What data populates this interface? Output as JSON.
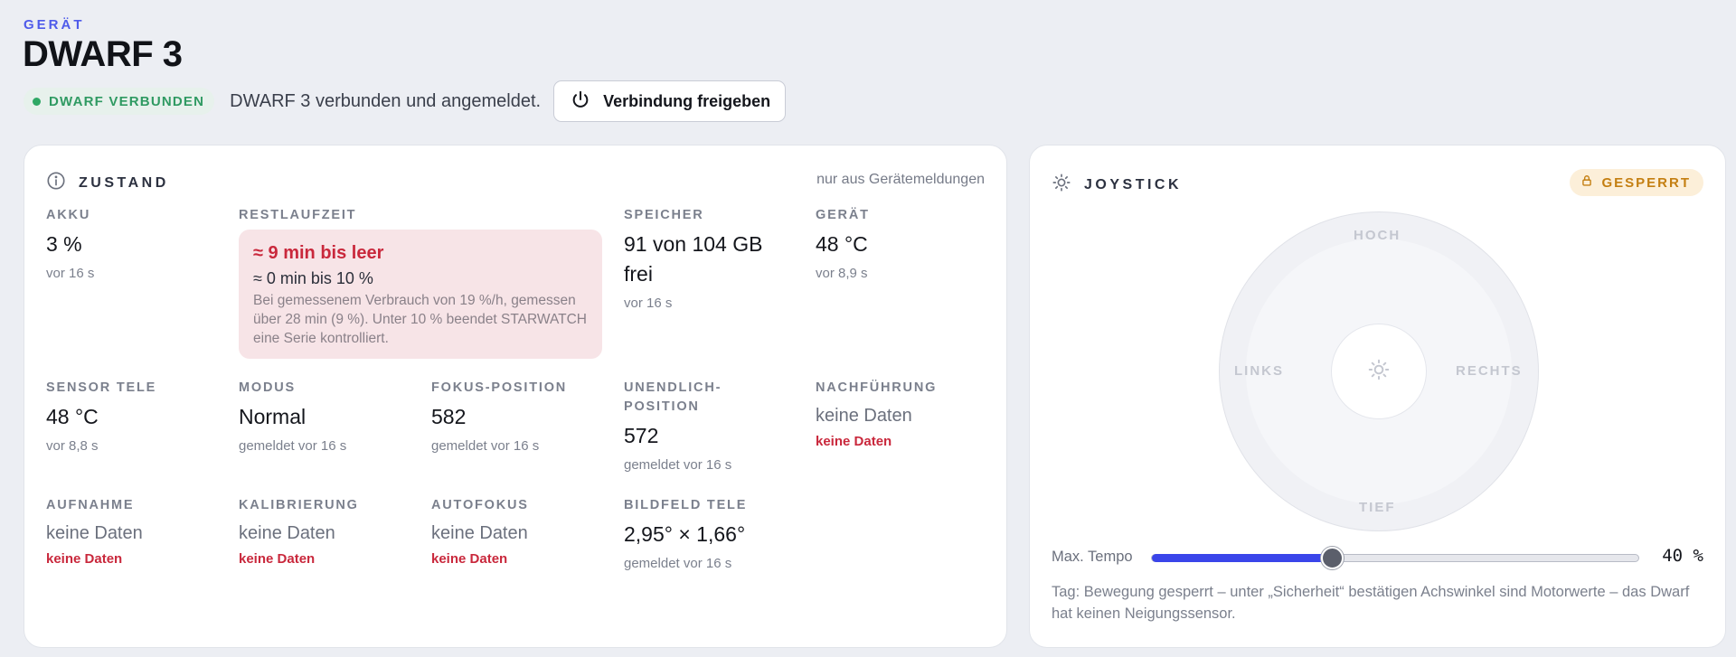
{
  "header": {
    "eyebrow": "GERÄT",
    "title": "DWARF 3",
    "connection_badge": "DWARF VERBUNDEN",
    "connection_text": "DWARF 3 verbunden und angemeldet.",
    "release_button": "Verbindung freigeben"
  },
  "state": {
    "title": "ZUSTAND",
    "note": "nur aus Gerätemeldungen",
    "akku": {
      "label": "AKKU",
      "value": "3 %",
      "sub": "vor 16 s"
    },
    "restlaufzeit": {
      "label": "RESTLAUFZEIT",
      "main": "≈ 9 min bis leer",
      "line": "≈ 0 min bis 10 %",
      "text": "Bei gemessenem Verbrauch von 19 %/h, gemessen über 28 min (9 %). Unter 10 % beendet STARWATCH eine Serie kontrolliert."
    },
    "speicher": {
      "label": "SPEICHER",
      "value_line1": "91 von 104 GB",
      "value_line2": "frei",
      "sub": "vor 16 s"
    },
    "geraet": {
      "label": "GERÄT",
      "value": "48 °C",
      "sub": "vor 8,9 s"
    },
    "sensor_tele": {
      "label": "SENSOR TELE",
      "value": "48 °C",
      "sub": "vor 8,8 s"
    },
    "modus": {
      "label": "MODUS",
      "value": "Normal",
      "sub": "gemeldet vor 16 s"
    },
    "fokus": {
      "label": "FOKUS-POSITION",
      "value": "582",
      "sub": "gemeldet vor 16 s"
    },
    "unendlich": {
      "label_line1": "UNENDLICH-",
      "label_line2": "POSITION",
      "value": "572",
      "sub": "gemeldet vor 16 s"
    },
    "nachfuehrung": {
      "label": "NACHFÜHRUNG",
      "value": "keine Daten",
      "sub": "keine Daten"
    },
    "aufnahme": {
      "label": "AUFNAHME",
      "value": "keine Daten",
      "sub": "keine Daten"
    },
    "kalibrierung": {
      "label": "KALIBRIERUNG",
      "value": "keine Daten",
      "sub": "keine Daten"
    },
    "autofokus": {
      "label": "AUTOFOKUS",
      "value": "keine Daten",
      "sub": "keine Daten"
    },
    "bildfeld": {
      "label": "BILDFELD TELE",
      "value": "2,95° × 1,66°",
      "sub": "gemeldet vor 16 s"
    }
  },
  "joystick": {
    "title": "JOYSTICK",
    "locked_badge": "GESPERRT",
    "dir_up": "HOCH",
    "dir_down": "TIEF",
    "dir_left": "LINKS",
    "dir_right": "RECHTS",
    "speed_label": "Max. Tempo",
    "speed_value": "40 %",
    "speed_fraction": 0.37,
    "hint": "Tag: Bewegung gesperrt – unter „Sicherheit“ bestätigen Achswinkel sind Motorwerte – das Dwarf hat keinen Neigungssensor."
  },
  "colors": {
    "accent": "#3a45ea",
    "ok": "#2fa865",
    "danger": "#c9283c",
    "warning": "#c47f12"
  },
  "icons": {
    "release": "power-icon",
    "state": "info-icon",
    "joystick": "sun-icon",
    "locked": "lock-icon"
  }
}
